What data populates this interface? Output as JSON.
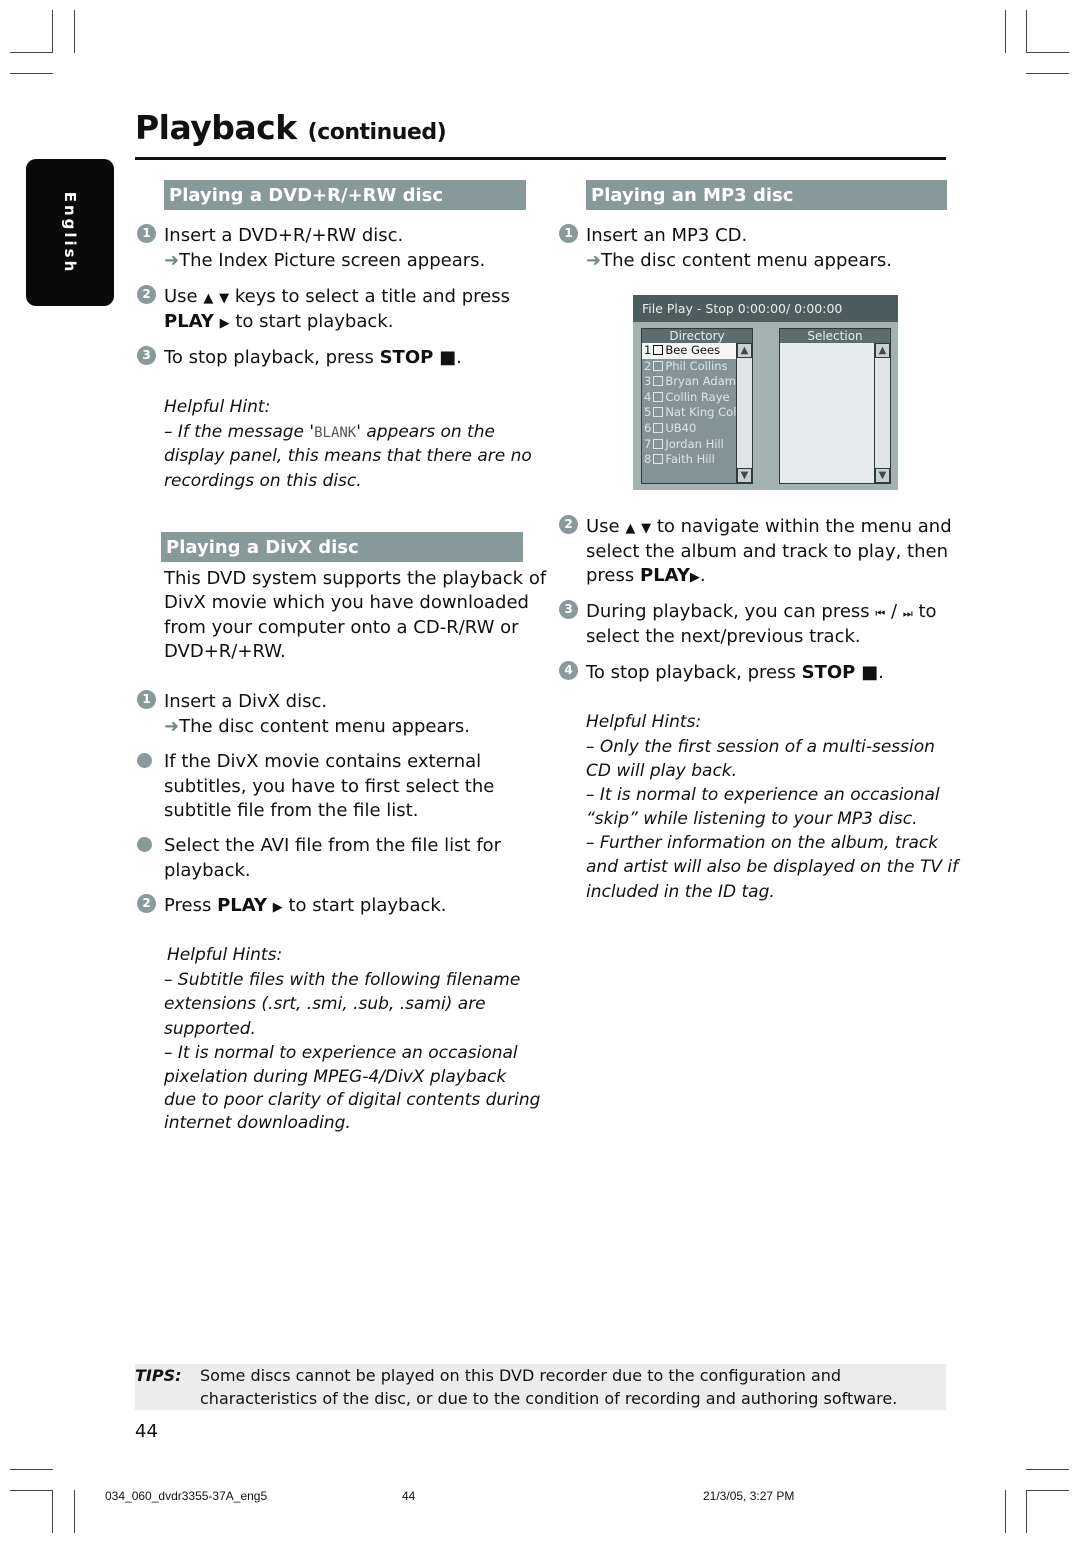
{
  "page": {
    "title": "Playback",
    "title_suffix": "(continued)",
    "language_tab": "English",
    "page_number": "44"
  },
  "dvd_section": {
    "heading": "Playing a DVD+R/+RW disc",
    "steps": [
      {
        "num": "1",
        "text": "Insert a DVD+R/+RW disc.",
        "result": "The Index Picture screen appears."
      },
      {
        "num": "2",
        "line1_pre": "Use",
        "line1_post": "keys to select a title and press",
        "line2_bold": "PLAY",
        "line2_post": "to start playback."
      },
      {
        "num": "3",
        "pre": "To stop playback, press",
        "bold": "STOP"
      }
    ],
    "hint_title": "Helpful Hint:",
    "hint_lines": [
      "–  If the message '",
      "BLANK",
      "' appears on the",
      "display panel, this means that there are no",
      "recordings on this disc."
    ]
  },
  "divx_section": {
    "heading": "Playing a DivX disc",
    "intro": [
      "This DVD system supports the playback of",
      "DivX movie which you have downloaded",
      "from your computer onto a CD-R/RW or",
      "DVD+R/+RW."
    ],
    "step1": {
      "num": "1",
      "text": "Insert a DivX disc.",
      "result": "The disc content menu appears."
    },
    "bullets": [
      [
        "If the DivX movie contains external",
        "subtitles, you have to first select the",
        "subtitle file from the file list."
      ],
      [
        "Select the AVI file from the file list for",
        "playback."
      ]
    ],
    "step2": {
      "num": "2",
      "pre": "Press",
      "bold": "PLAY",
      "post": "to start playback."
    },
    "hints_title": "Helpful Hints:",
    "hints_lines": [
      "–  Subtitle files with the following filename",
      "extensions (.srt, .smi, .sub, .sami) are",
      "supported.",
      "–  It is normal to experience an occasional",
      "pixelation during MPEG-4/DivX playback",
      "due to poor clarity of digital contents during",
      "internet downloading."
    ]
  },
  "mp3_section": {
    "heading": "Playing an MP3 disc",
    "step1": {
      "num": "1",
      "text": "Insert an MP3 CD.",
      "result": "The disc content menu appears."
    },
    "menu": {
      "status": "File Play - Stop 0:00:00/ 0:00:00",
      "directory_label": "Directory",
      "selection_label": "Selection",
      "items": [
        "Bee Gees",
        "Phil Collins",
        "Bryan Adams",
        "Collin Raye",
        "Nat King Cole",
        "UB40",
        "Jordan Hill",
        "Faith Hill"
      ],
      "selected_index": 0
    },
    "step2": {
      "num": "2",
      "lines": [
        "to navigate within the menu and",
        "select the album and track to play, then",
        "press"
      ],
      "pre": "Use",
      "bold": "PLAY"
    },
    "step3": {
      "num": "3",
      "line1_pre": "During playback, you can press",
      "line1_post": "to",
      "line2": "select the next/previous track."
    },
    "step4": {
      "num": "4",
      "pre": "To stop playback, press",
      "bold": "STOP"
    },
    "hints_title": "Helpful Hints:",
    "hints_lines": [
      "–  Only the first session of a multi-session",
      "CD will play back.",
      "– It is normal to experience an occasional",
      "“skip” while listening to your MP3 disc.",
      "–  Further information on the album, track",
      "and artist will also be displayed on the TV if",
      "included in the ID tag."
    ]
  },
  "tips": {
    "label": "TIPS:",
    "lines": [
      "Some discs cannot be played on this DVD recorder due to the configuration and",
      "characteristics of the disc, or due to the condition of recording and authoring software."
    ]
  },
  "footer": {
    "file": "034_060_dvdr3355-37A_eng5",
    "page": "44",
    "timestamp": "21/3/05, 3:27 PM"
  },
  "colors": {
    "section_header": "#889999",
    "step_badge": "#8a9a9a",
    "menu_bar": "#4d5d5d"
  }
}
